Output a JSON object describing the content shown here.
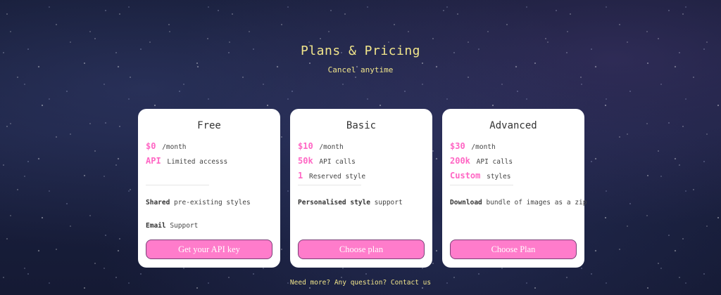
{
  "header": {
    "title": "Plans & Pricing",
    "subtitle": "Cancel anytime"
  },
  "plans": [
    {
      "name": "Free",
      "features": [
        {
          "highlight": "$0",
          "text": "/month"
        },
        {
          "highlight": "API",
          "text": "Limited accesss"
        }
      ],
      "extras": [
        {
          "bold": "Shared",
          "text": " pre-existing styles"
        },
        {
          "bold": "Email",
          "text": " Support"
        }
      ],
      "button": "Get your API key"
    },
    {
      "name": "Basic",
      "features": [
        {
          "highlight": "$10",
          "text": "/month"
        },
        {
          "highlight": "50k",
          "text": "API calls"
        },
        {
          "highlight": "1",
          "text": "Reserved style"
        }
      ],
      "extras": [
        {
          "bold": "Personalised style",
          "text": " support"
        }
      ],
      "button": "Choose plan"
    },
    {
      "name": "Advanced",
      "features": [
        {
          "highlight": "$30",
          "text": "/month"
        },
        {
          "highlight": "200k",
          "text": "API calls"
        },
        {
          "highlight": "Custom",
          "text": "styles"
        }
      ],
      "extras": [
        {
          "bold": "Download",
          "text": " bundle of images as a zip"
        }
      ],
      "button": "Choose Plan"
    }
  ],
  "footer": {
    "text": "Need more? Any question? Contact us"
  },
  "colors": {
    "accent_pink": "#ff66c4",
    "button_pink": "#ff7ccb",
    "heading_yellow": "#f1e58b",
    "card_bg": "#ffffff"
  }
}
